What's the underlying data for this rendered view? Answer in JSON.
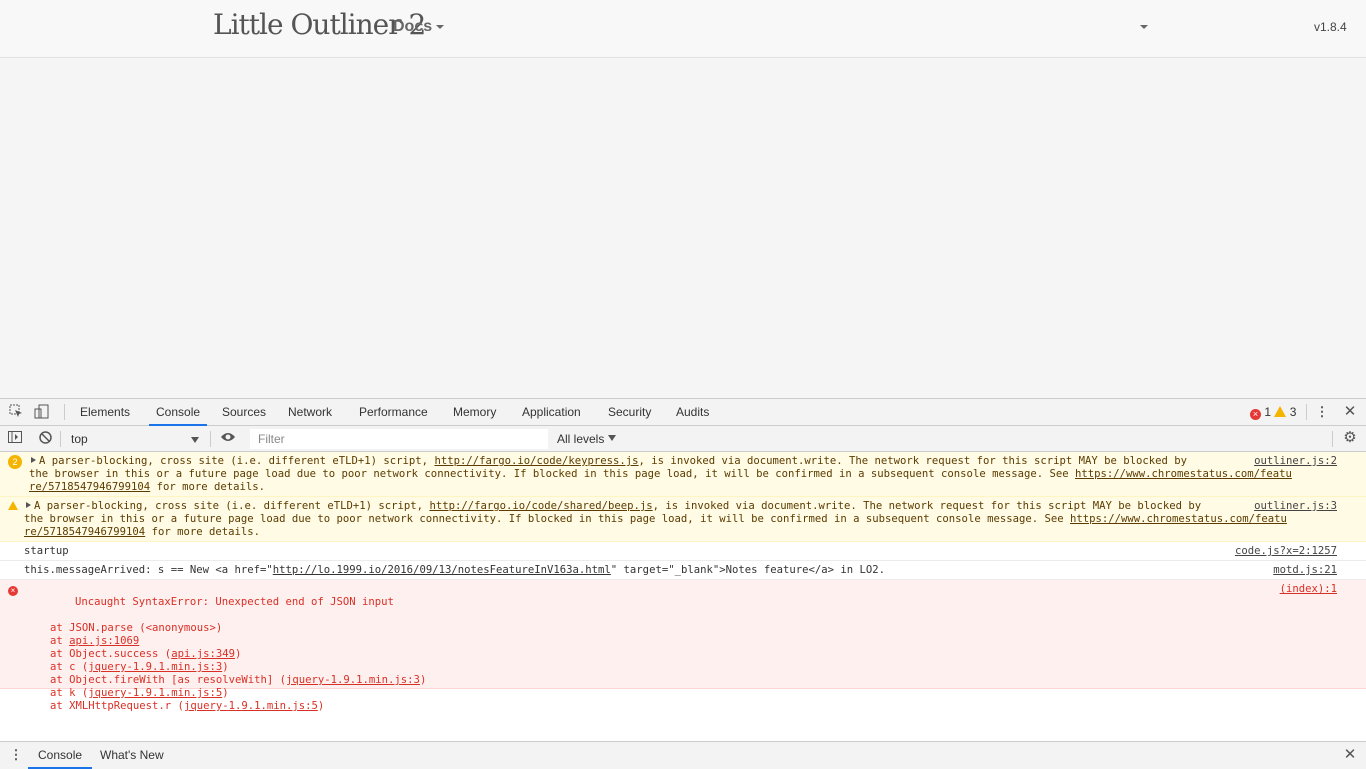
{
  "app": {
    "title": "Little Outliner 2",
    "docs_menu": "Docs",
    "version": "v1.8.4"
  },
  "devtools": {
    "tabs": [
      "Elements",
      "Console",
      "Sources",
      "Network",
      "Performance",
      "Memory",
      "Application",
      "Security",
      "Audits"
    ],
    "active_tab": "Console",
    "error_count": "1",
    "warning_count": "3",
    "context": "top",
    "filter_placeholder": "Filter",
    "levels": "All levels",
    "messages": {
      "m1": {
        "count": "2",
        "text_a": "A parser-blocking, cross site (i.e. different eTLD+1) script, ",
        "link": "http://fargo.io/code/keypress.js",
        "text_b": ", is invoked via document.write. The network request for this script MAY be blocked by",
        "text_c": "the browser in this or a future page load due to poor network connectivity. If blocked in this page load, it will be confirmed in a subsequent console message. See ",
        "link2": "https://www.chromestatus.com/featu",
        "link3": "re/5718547946799104",
        "text_d": " for more details.",
        "source": "outliner.js:2"
      },
      "m2": {
        "text_a": "A parser-blocking, cross site (i.e. different eTLD+1) script, ",
        "link": "http://fargo.io/code/shared/beep.js",
        "text_b": ", is invoked via document.write. The network request for this script MAY be blocked by",
        "text_c": "the browser in this or a future page load due to poor network connectivity. If blocked in this page load, it will be confirmed in a subsequent console message. See ",
        "link2": "https://www.chromestatus.com/featu",
        "link3": "re/5718547946799104",
        "text_d": " for more details.",
        "source": "outliner.js:3"
      },
      "m3": {
        "text": "startup",
        "source": "code.js?x=2:1257"
      },
      "m4": {
        "text_a": "this.messageArrived: s == New <a href=\"",
        "link": "http://lo.1999.io/2016/09/13/notesFeatureInV163a.html",
        "text_b": "\" target=\"_blank\">Notes feature</a> in LO2.",
        "source": "motd.js:21"
      },
      "m5": {
        "text": "Uncaught SyntaxError: Unexpected end of JSON input",
        "source": "(index):1",
        "stack": [
          {
            "pre": "at JSON.parse (<anonymous>)",
            "link": "",
            "post": ""
          },
          {
            "pre": "at ",
            "link": "api.js:1069",
            "post": ""
          },
          {
            "pre": "at Object.success (",
            "link": "api.js:349",
            "post": ")"
          },
          {
            "pre": "at c (",
            "link": "jquery-1.9.1.min.js:3",
            "post": ")"
          },
          {
            "pre": "at Object.fireWith [as resolveWith] (",
            "link": "jquery-1.9.1.min.js:3",
            "post": ")"
          },
          {
            "pre": "at k (",
            "link": "jquery-1.9.1.min.js:5",
            "post": ")"
          },
          {
            "pre": "at XMLHttpRequest.r (",
            "link": "jquery-1.9.1.min.js:5",
            "post": ")"
          }
        ]
      }
    },
    "drawer_tabs": [
      "Console",
      "What's New"
    ]
  }
}
